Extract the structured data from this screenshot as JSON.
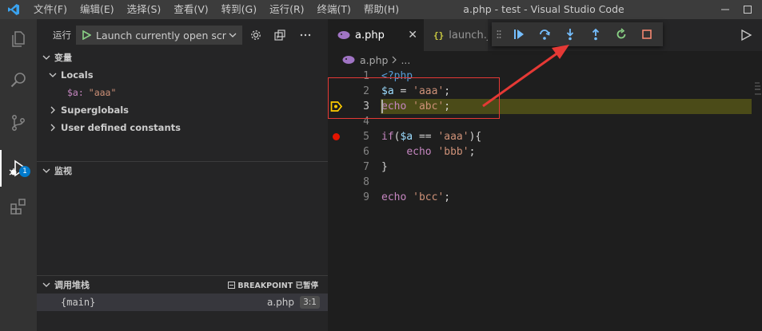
{
  "titlebar": {
    "menu": [
      "文件(F)",
      "编辑(E)",
      "选择(S)",
      "查看(V)",
      "转到(G)",
      "运行(R)",
      "终端(T)",
      "帮助(H)"
    ],
    "title": "a.php - test - Visual Studio Code"
  },
  "activity_bar": {
    "items": [
      "explorer-icon",
      "search-icon",
      "source-control-icon",
      "run-debug-icon",
      "extensions-icon"
    ],
    "debug_badge": "1"
  },
  "sidebar": {
    "run_label": "运行",
    "launch_config": "Launch currently open script",
    "variables": {
      "header": "变量",
      "locals_label": "Locals",
      "local_var_name": "$a:",
      "local_var_value": "\"aaa\"",
      "superglobals_label": "Superglobals",
      "constants_label": "User defined constants"
    },
    "watch": {
      "header": "监视"
    },
    "call_stack": {
      "header": "调用堆栈",
      "status": "BREAKPOINT 已暂停",
      "frame": {
        "name": "{main}",
        "file": "a.php",
        "position": "3:1"
      }
    }
  },
  "editor": {
    "tabs": [
      {
        "label": "a.php",
        "active": true
      },
      {
        "label": "launch.json",
        "active": false
      }
    ],
    "breadcrumb": {
      "file": "a.php",
      "more": "..."
    },
    "debug_toolbar": [
      "continue-icon",
      "step-over-icon",
      "step-into-icon",
      "step-out-icon",
      "restart-icon",
      "stop-icon"
    ],
    "current_line": 3,
    "breakpoint_line": 5,
    "lines": [
      {
        "n": "1",
        "text": "<?php"
      },
      {
        "n": "2",
        "text": "$a = 'aaa';"
      },
      {
        "n": "3",
        "text": "echo 'abc';"
      },
      {
        "n": "4",
        "text": ""
      },
      {
        "n": "5",
        "text": "if($a == 'aaa'){"
      },
      {
        "n": "6",
        "text": "    echo 'bbb';"
      },
      {
        "n": "7",
        "text": "}"
      },
      {
        "n": "8",
        "text": ""
      },
      {
        "n": "9",
        "text": "echo 'bcc';"
      }
    ]
  },
  "colors": {
    "accent": "#007acc",
    "breakpoint": "#e51400",
    "current_line_bg": "#4b4b18",
    "annotation": "#e53935"
  }
}
